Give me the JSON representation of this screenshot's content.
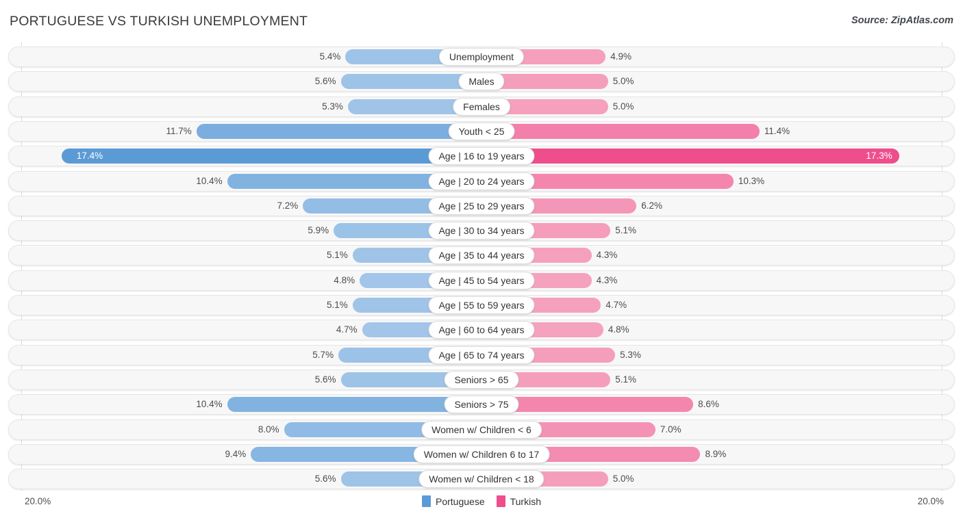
{
  "header": {
    "title": "PORTUGUESE VS TURKISH UNEMPLOYMENT",
    "source": "Source: ZipAtlas.com"
  },
  "footer": {
    "axis_min_label": "20.0%",
    "axis_max_label": "20.0%",
    "legend": [
      {
        "name": "Portuguese",
        "color": "#5b9bd5"
      },
      {
        "name": "Turkish",
        "color": "#ef4e8c"
      }
    ]
  },
  "chart_data": {
    "type": "bar",
    "subtype": "diverging-bidirectional",
    "title": "PORTUGUESE VS TURKISH UNEMPLOYMENT",
    "source": "Source: ZipAtlas.com",
    "xlabel": "",
    "ylabel": "",
    "xlim": [
      -20.0,
      20.0
    ],
    "axis_max": 20.0,
    "unit": "%",
    "grid": true,
    "legend_position": "bottom-center",
    "categories": [
      "Unemployment",
      "Males",
      "Females",
      "Youth < 25",
      "Age | 16 to 19 years",
      "Age | 20 to 24 years",
      "Age | 25 to 29 years",
      "Age | 30 to 34 years",
      "Age | 35 to 44 years",
      "Age | 45 to 54 years",
      "Age | 55 to 59 years",
      "Age | 60 to 64 years",
      "Age | 65 to 74 years",
      "Seniors > 65",
      "Seniors > 75",
      "Women w/ Children < 6",
      "Women w/ Children 6 to 17",
      "Women w/ Children < 18"
    ],
    "series": [
      {
        "name": "Portuguese",
        "side": "left",
        "color": "#5b9bd5",
        "values": [
          5.4,
          5.6,
          5.3,
          11.7,
          17.4,
          10.4,
          7.2,
          5.9,
          5.1,
          4.8,
          5.1,
          4.7,
          5.7,
          5.6,
          10.4,
          8.0,
          9.4,
          5.6
        ],
        "labels": [
          "5.4%",
          "5.6%",
          "5.3%",
          "11.7%",
          "17.4%",
          "10.4%",
          "7.2%",
          "5.9%",
          "5.1%",
          "4.8%",
          "5.1%",
          "4.7%",
          "5.7%",
          "5.6%",
          "10.4%",
          "8.0%",
          "9.4%",
          "5.6%"
        ]
      },
      {
        "name": "Turkish",
        "side": "right",
        "color": "#ef4e8c",
        "values": [
          4.9,
          5.0,
          5.0,
          11.4,
          17.3,
          10.3,
          6.2,
          5.1,
          4.3,
          4.3,
          4.7,
          4.8,
          5.3,
          5.1,
          8.6,
          7.0,
          8.9,
          5.0
        ],
        "labels": [
          "4.9%",
          "5.0%",
          "5.0%",
          "11.4%",
          "17.3%",
          "10.3%",
          "6.2%",
          "5.1%",
          "4.3%",
          "4.3%",
          "4.7%",
          "4.8%",
          "5.3%",
          "5.1%",
          "8.6%",
          "7.0%",
          "8.9%",
          "5.0%"
        ]
      }
    ],
    "highlighted_row": "Age | 16 to 19 years"
  }
}
